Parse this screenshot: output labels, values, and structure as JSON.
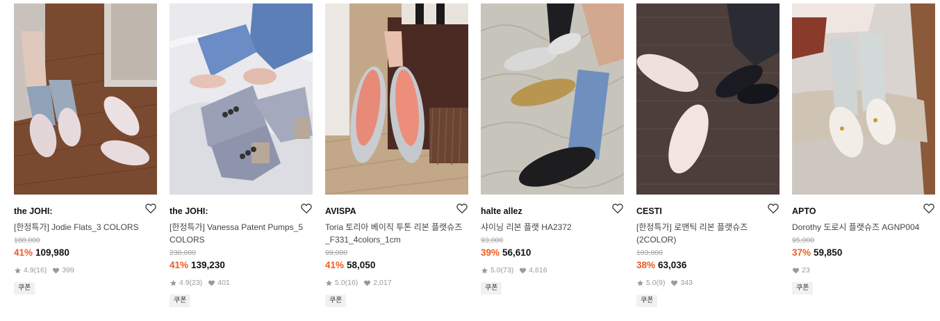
{
  "colors": {
    "discount": "#ef5a21",
    "price": "#111111",
    "muted": "#a0a0a0"
  },
  "products": [
    {
      "brand": "the JOHI:",
      "name": "[한정특가] Jodie Flats_3 COLORS",
      "original_price": "188,000",
      "discount": "41%",
      "price": "109,980",
      "rating": "4.9",
      "reviews": "(16)",
      "likes": "399",
      "coupon": "쿠폰",
      "image_icon": "flats-photo"
    },
    {
      "brand": "the JOHI:",
      "name": "[한정특가] Vanessa Patent Pumps_5 COLORS",
      "original_price": "238,000",
      "discount": "41%",
      "price": "139,230",
      "rating": "4.9",
      "reviews": "(23)",
      "likes": "401",
      "coupon": "쿠폰",
      "image_icon": "tweed-pumps-photo"
    },
    {
      "brand": "AVISPA",
      "name": "Toria 토리아 베이직 투톤 리본 플랫슈즈_F331_4colors_1cm",
      "original_price": "99,000",
      "discount": "41%",
      "price": "58,050",
      "rating": "5.0",
      "reviews": "(16)",
      "likes": "2,017",
      "coupon": "쿠폰",
      "image_icon": "silver-flats-photo"
    },
    {
      "brand": "halte allez",
      "name": "샤이닝 리본 플랫 HA2372",
      "original_price": "93,000",
      "discount": "39%",
      "price": "56,610",
      "rating": "5.0",
      "reviews": "(73)",
      "likes": "4,616",
      "coupon": "쿠폰",
      "image_icon": "ribbon-flats-photo"
    },
    {
      "brand": "CESTI",
      "name": "[한정특가] 로맨틱 리본 플랫슈즈 (2COLOR)",
      "original_price": "103,000",
      "discount": "38%",
      "price": "63,036",
      "rating": "5.0",
      "reviews": "(9)",
      "likes": "343",
      "coupon": "쿠폰",
      "image_icon": "romantic-flats-photo"
    },
    {
      "brand": "APTO",
      "name": "Dorothy 도로시 플랫슈즈 AGNP004",
      "original_price": "95,000",
      "discount": "37%",
      "price": "59,850",
      "rating": "",
      "reviews": "",
      "likes": "23",
      "coupon": "쿠폰",
      "image_icon": "mary-jane-flats-photo"
    }
  ]
}
